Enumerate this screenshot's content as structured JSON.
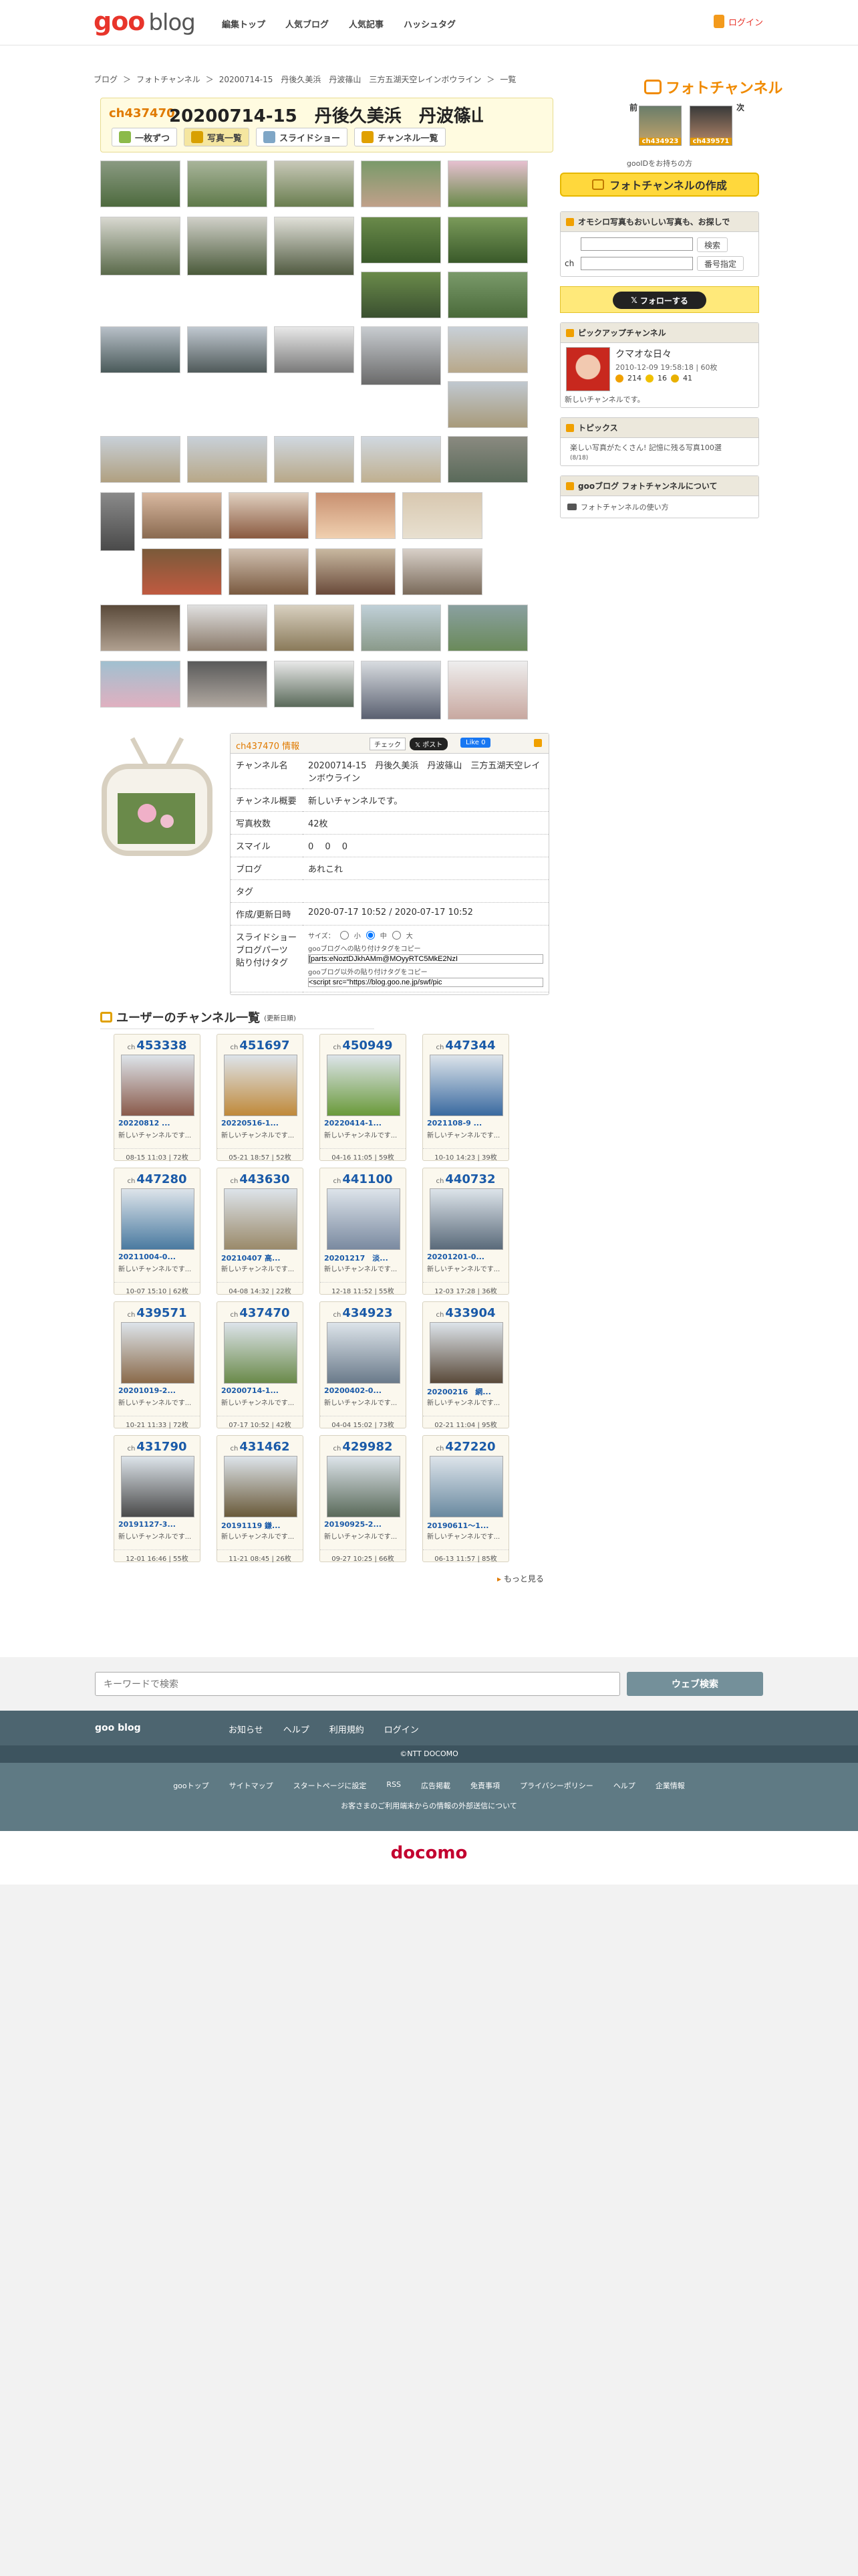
{
  "header": {
    "logo_goo": "goo",
    "logo_blog": "blog",
    "nav": [
      "編集トップ",
      "人気ブログ",
      "人気記事",
      "ハッシュタグ"
    ],
    "login": "ログイン"
  },
  "breadcrumb": [
    "ブログ",
    "＞",
    "フォトチャンネル",
    "＞",
    "20200714-15　丹後久美浜　丹波篠山　三方五湖天空レインボウライン",
    "＞",
    "一覧"
  ],
  "photochannel_logo": "フォトチャンネル",
  "channel": {
    "ch_label": "ch437470",
    "title": "20200714-15　丹後久美浜　丹波篠山　三方五湖天空レ...",
    "buttons": [
      "一枚ずつ",
      "写真一覧",
      "スライドショー",
      "チャンネル一覧"
    ],
    "prev": "前",
    "next": "次",
    "prev_ch": "ch434923",
    "next_ch": "ch439571"
  },
  "sidebar": {
    "gooid_note": "gooIDをお持ちの方",
    "make_button": "フォトチャンネルの作成",
    "search": {
      "title": "オモシロ写真もおいしい写真も、お探しで",
      "btn": "検索",
      "ch_label": "ch",
      "btn2": "番号指定"
    },
    "follow": "フォローする",
    "pickup": {
      "title": "ピックアップチャンネル",
      "name": "クマオな日々",
      "meta": "2010-12-09 19:58:18 | 60枚",
      "s1": "214",
      "s2": "16",
      "s3": "41",
      "desc": "新しいチャンネルです。"
    },
    "topics": {
      "title": "トピックス",
      "item": "楽しい写真がたくさん! 記憶に残る写真100選",
      "date": "(8/18)"
    },
    "about": {
      "title": "gooブログ フォトチャンネルについて",
      "link": "フォトチャンネルの使い方"
    }
  },
  "info": {
    "head": "ch437470 情報",
    "chk": "チェック",
    "post": "ポスト",
    "like": "Like 0",
    "rows": [
      {
        "k": "チャンネル名",
        "v": "20200714-15　丹後久美浜　丹波篠山　三方五湖天空レインボウライン"
      },
      {
        "k": "チャンネル概要",
        "v": "新しいチャンネルです。"
      },
      {
        "k": "写真枚数",
        "v": "42枚"
      },
      {
        "k": "スマイル",
        "v": "0　 0　 0"
      },
      {
        "k": "ブログ",
        "v": "あれこれ"
      },
      {
        "k": "タグ",
        "v": ""
      },
      {
        "k": "作成/更新日時",
        "v": "2020-07-17 10:52 / 2020-07-17 10:52"
      }
    ],
    "slide_k": "スライドショー ブログパーツ 貼り付けタグ",
    "size": "サイズ：",
    "small": "小",
    "mid": "中",
    "large": "大",
    "note1": "gooブログへの貼り付けタグをコピー",
    "code1": "[parts:eNoztDJkhAMm@MOyyRTC5MkE2NzI",
    "note2": "gooブログ以外の貼り付けタグをコピー",
    "code2": "<script src=\"https://blog.goo.ne.jp/swf/pic"
  },
  "userlist": {
    "title": "ユーザーのチャンネル一覧",
    "sub": "(更新日順)",
    "more": "もっと見る",
    "cards": [
      {
        "no": "453338",
        "t": "20220812 ...",
        "d": "新しいチャンネルです...",
        "m": "08-15 11:03 | 72枚"
      },
      {
        "no": "451697",
        "t": "20220516-1...",
        "d": "新しいチャンネルです...",
        "m": "05-21 18:57 | 52枚"
      },
      {
        "no": "450949",
        "t": "20220414-1...",
        "d": "新しいチャンネルです...",
        "m": "04-16 11:05 | 59枚"
      },
      {
        "no": "447344",
        "t": "2021108-9 ...",
        "d": "新しいチャンネルです...",
        "m": "10-10 14:23 | 39枚"
      },
      {
        "no": "447280",
        "t": "20211004-0...",
        "d": "新しいチャンネルです...",
        "m": "10-07 15:10 | 62枚"
      },
      {
        "no": "443630",
        "t": "20210407 高...",
        "d": "新しいチャンネルです...",
        "m": "04-08 14:32 | 22枚"
      },
      {
        "no": "441100",
        "t": "20201217　淡...",
        "d": "新しいチャンネルです...",
        "m": "12-18 11:52 | 55枚"
      },
      {
        "no": "440732",
        "t": "20201201-0...",
        "d": "新しいチャンネルです...",
        "m": "12-03 17:28 | 36枚"
      },
      {
        "no": "439571",
        "t": "20201019-2...",
        "d": "新しいチャンネルです...",
        "m": "10-21 11:33 | 72枚"
      },
      {
        "no": "437470",
        "t": "20200714-1...",
        "d": "新しいチャンネルです...",
        "m": "07-17 10:52 | 42枚"
      },
      {
        "no": "434923",
        "t": "20200402-0...",
        "d": "新しいチャンネルです...",
        "m": "04-04 15:02 | 73枚"
      },
      {
        "no": "433904",
        "t": "20200216　網...",
        "d": "新しいチャンネルです...",
        "m": "02-21 11:04 | 95枚"
      },
      {
        "no": "431790",
        "t": "20191127-3...",
        "d": "新しいチャンネルです...",
        "m": "12-01 16:46 | 55枚"
      },
      {
        "no": "431462",
        "t": "20191119 鎌...",
        "d": "新しいチャンネルです...",
        "m": "11-21 08:45 | 26枚"
      },
      {
        "no": "429982",
        "t": "20190925-2...",
        "d": "新しいチャンネルです...",
        "m": "09-27 10:25 | 66枚"
      },
      {
        "no": "427220",
        "t": "20190611〜1...",
        "d": "新しいチャンネルです...",
        "m": "06-13 11:57 | 85枚"
      }
    ]
  },
  "footer": {
    "placeholder": "キーワードで検索",
    "search_btn": "ウェブ検索",
    "logo": "goo blog",
    "nav": [
      "お知らせ",
      "ヘルプ",
      "利用規約",
      "ログイン"
    ],
    "copy": "©NTT DOCOMO",
    "links": [
      "gooトップ",
      "サイトマップ",
      "スタートページに設定",
      "RSS",
      "広告掲載",
      "免責事項",
      "プライバシーポリシー",
      "ヘルプ",
      "企業情報"
    ],
    "note": "お客さまのご利用端末からの情報の外部送信について",
    "docomo": "docomo"
  }
}
